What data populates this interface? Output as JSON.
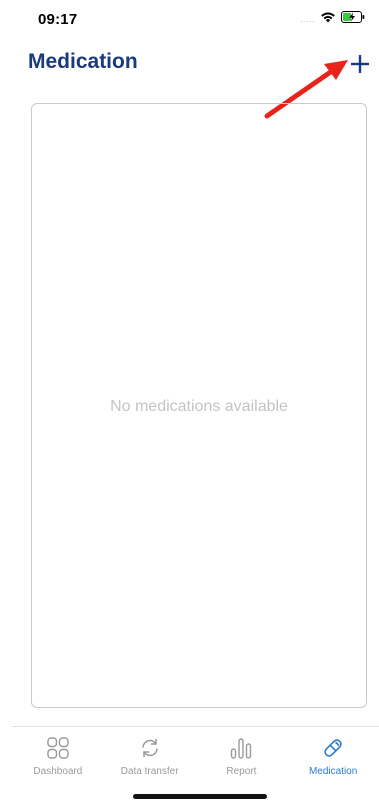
{
  "status_bar": {
    "time": "09:17",
    "signal_dots": ".....",
    "icons": [
      "wifi-icon",
      "battery-charging-icon"
    ]
  },
  "header": {
    "title": "Medication",
    "add_icon": "plus-icon"
  },
  "annotation": {
    "arrow_color": "#e8231c"
  },
  "content": {
    "empty_message": "No medications available"
  },
  "tab_bar": {
    "items": [
      {
        "label": "Dashboard",
        "icon": "dashboard-grid-icon",
        "active": false
      },
      {
        "label": "Data transfer",
        "icon": "sync-icon",
        "active": false
      },
      {
        "label": "Report",
        "icon": "bar-chart-icon",
        "active": false
      },
      {
        "label": "Medication",
        "icon": "pill-icon",
        "active": true
      }
    ]
  },
  "colors": {
    "title": "#1b3a7e",
    "accent": "#2a7bd3",
    "inactive": "#9a9a9a",
    "empty_text": "#c4c4c4",
    "card_border": "#c9c9c9"
  }
}
